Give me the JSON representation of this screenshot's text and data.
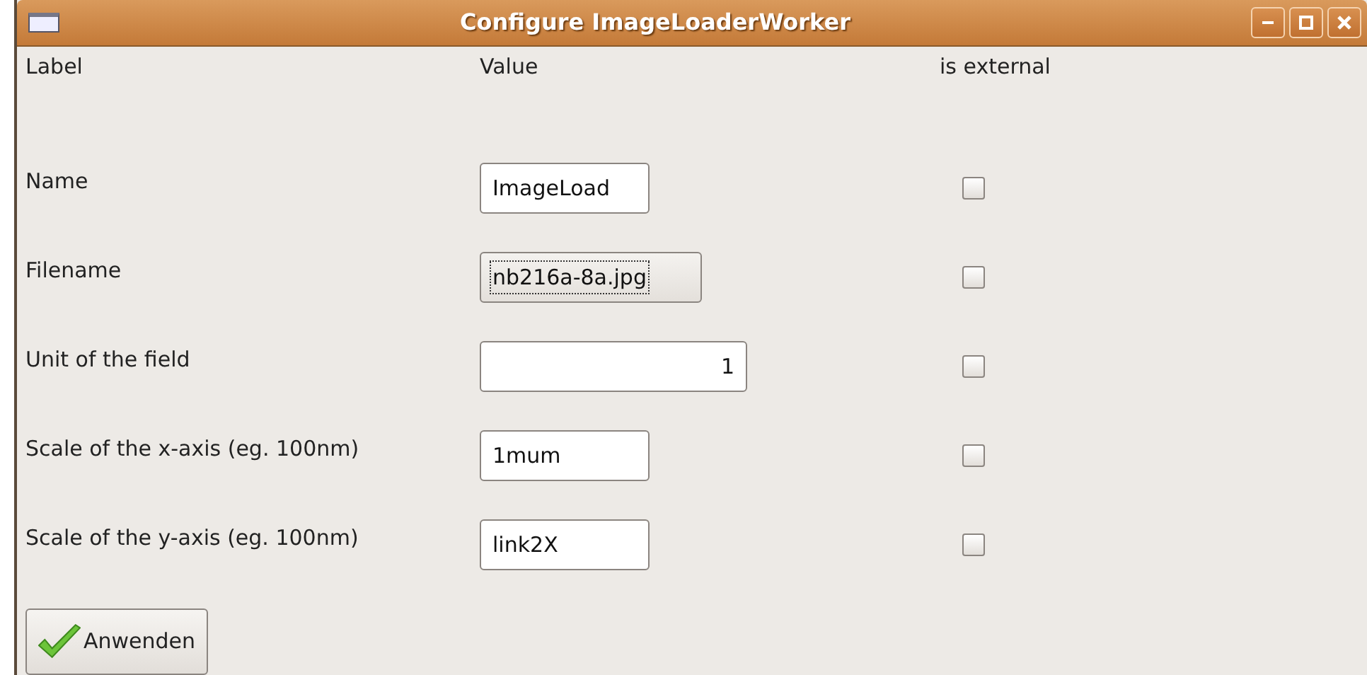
{
  "window": {
    "title": "Configure ImageLoaderWorker"
  },
  "columns": [
    "Label",
    "Value",
    "is external"
  ],
  "rows": [
    {
      "label": "Name",
      "kind": "text",
      "value": "ImageLoad",
      "focused": false,
      "external": false
    },
    {
      "label": "Filename",
      "kind": "file",
      "value": "nb216a-8a.jpg",
      "focused": true,
      "external": false
    },
    {
      "label": "Unit of the field",
      "kind": "number",
      "value": "1",
      "focused": false,
      "external": false
    },
    {
      "label": "Scale of the x-axis (eg. 100nm)",
      "kind": "text",
      "value": "1mum",
      "focused": false,
      "external": false
    },
    {
      "label": "Scale of the y-axis (eg. 100nm)",
      "kind": "text",
      "value": "link2X",
      "focused": false,
      "external": false
    }
  ],
  "apply_button": {
    "label": "Anwenden"
  }
}
